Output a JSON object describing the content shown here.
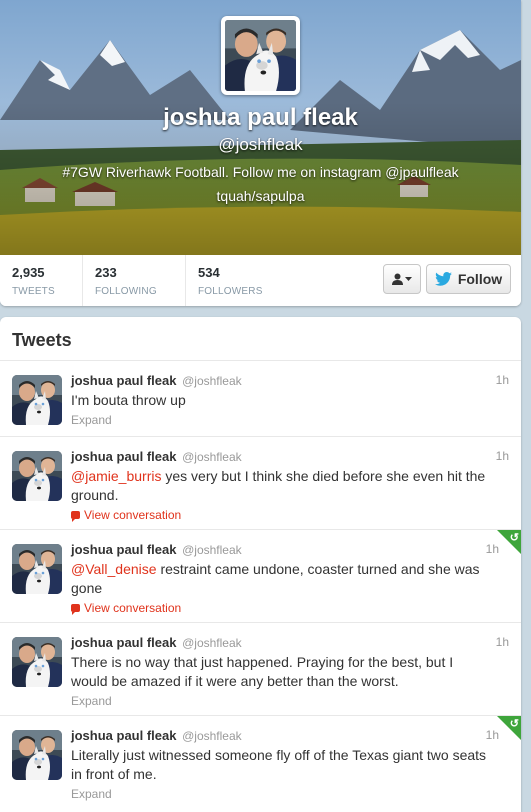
{
  "profile": {
    "full_name": "joshua paul fleak",
    "screen_name": "@joshfleak",
    "bio": "#7GW Riverhawk Football. Follow me on instagram @jpaulfleak",
    "location": "tquah/sapulpa"
  },
  "stats": [
    {
      "value": "2,935",
      "label": "TWEETS"
    },
    {
      "value": "233",
      "label": "FOLLOWING"
    },
    {
      "value": "534",
      "label": "FOLLOWERS"
    }
  ],
  "actions": {
    "follow_label": "Follow",
    "user_icon": "person-icon",
    "dropdown_icon": "caret-down-icon",
    "bird_icon": "twitter-bird-icon"
  },
  "tweets_heading": "Tweets",
  "tweets": [
    {
      "name": "joshua paul fleak",
      "handle": "@joshfleak",
      "time": "1h",
      "mention": "",
      "text": "I'm bouta throw up",
      "action": "Expand",
      "retweeted": false
    },
    {
      "name": "joshua paul fleak",
      "handle": "@joshfleak",
      "time": "1h",
      "mention": "@jamie_burris",
      "text": " yes very but I think she died before she even hit the ground.",
      "action": "View conversation",
      "retweeted": false
    },
    {
      "name": "joshua paul fleak",
      "handle": "@joshfleak",
      "time": "1h",
      "mention": "@Vall_denise",
      "text": " restraint came undone, coaster turned and she was gone",
      "action": "View conversation",
      "retweeted": true
    },
    {
      "name": "joshua paul fleak",
      "handle": "@joshfleak",
      "time": "1h",
      "mention": "",
      "text": "There is no way that just happened. Praying for the best, but I would be amazed if it were any better than the worst.",
      "action": "Expand",
      "retweeted": false
    },
    {
      "name": "joshua paul fleak",
      "handle": "@joshfleak",
      "time": "1h",
      "mention": "",
      "text": "Literally just witnessed someone fly off of the Texas giant two seats in front of me.",
      "action": "Expand",
      "retweeted": true
    }
  ],
  "colors": {
    "background": "#c9d8e2",
    "link_red": "#e0331c",
    "twitter_blue": "#2aa9e0",
    "retweet_green": "#3ea53b"
  }
}
